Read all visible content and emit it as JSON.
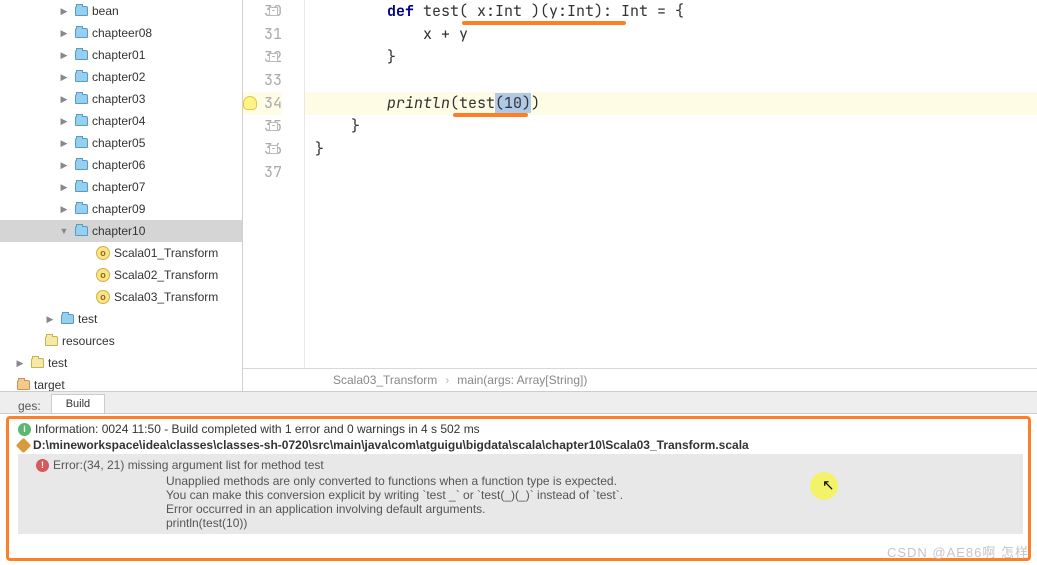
{
  "tree": {
    "items": [
      {
        "indent": 58,
        "arrow": ">",
        "icon": "folder",
        "label": "bean"
      },
      {
        "indent": 58,
        "arrow": ">",
        "icon": "folder",
        "label": "chapteer08"
      },
      {
        "indent": 58,
        "arrow": ">",
        "icon": "folder",
        "label": "chapter01"
      },
      {
        "indent": 58,
        "arrow": ">",
        "icon": "folder",
        "label": "chapter02"
      },
      {
        "indent": 58,
        "arrow": ">",
        "icon": "folder",
        "label": "chapter03"
      },
      {
        "indent": 58,
        "arrow": ">",
        "icon": "folder",
        "label": "chapter04"
      },
      {
        "indent": 58,
        "arrow": ">",
        "icon": "folder",
        "label": "chapter05"
      },
      {
        "indent": 58,
        "arrow": ">",
        "icon": "folder",
        "label": "chapter06"
      },
      {
        "indent": 58,
        "arrow": ">",
        "icon": "folder",
        "label": "chapter07"
      },
      {
        "indent": 58,
        "arrow": ">",
        "icon": "folder",
        "label": "chapter09"
      },
      {
        "indent": 58,
        "arrow": "v",
        "icon": "folder",
        "label": "chapter10",
        "sel": true
      },
      {
        "indent": 80,
        "arrow": "",
        "icon": "obj",
        "label": "Scala01_Transform"
      },
      {
        "indent": 80,
        "arrow": "",
        "icon": "obj",
        "label": "Scala02_Transform"
      },
      {
        "indent": 80,
        "arrow": "",
        "icon": "obj",
        "label": "Scala03_Transform"
      },
      {
        "indent": 44,
        "arrow": ">",
        "icon": "folder",
        "label": "test"
      },
      {
        "indent": 28,
        "arrow": "",
        "icon": "folder-res",
        "label": "resources"
      },
      {
        "indent": 14,
        "arrow": ">",
        "icon": "folder-res",
        "label": "test"
      },
      {
        "indent": 0,
        "arrow": "",
        "icon": "folder-tgt",
        "label": "target"
      }
    ]
  },
  "editor": {
    "lines": [
      {
        "num": "30",
        "fold": true
      },
      {
        "num": "31"
      },
      {
        "num": "32",
        "fold": true
      },
      {
        "num": "33"
      },
      {
        "num": "34",
        "hl": true,
        "bulb": true
      },
      {
        "num": "35",
        "fold": true
      },
      {
        "num": "36",
        "fold": true
      },
      {
        "num": "37"
      }
    ],
    "code30": {
      "pre": "        ",
      "kw": "def",
      "mid": " test( x:Int )(y:Int): Int = {"
    },
    "code31": "            x + y",
    "code32": "        }",
    "code33": "",
    "code34": {
      "pre": "        ",
      "fn": "println",
      "open": "(test",
      "sel": "(10)",
      "close": ")"
    },
    "code35": "    }",
    "code36": "}",
    "code37": ""
  },
  "breadcrumb": {
    "a": "Scala03_Transform",
    "b": "main(args: Array[String])"
  },
  "tabs": {
    "left": "ges:",
    "build": "Build"
  },
  "build": {
    "info": "Information: 0024 11:50 - Build completed with 1 error and 0 warnings in 4 s 502 ms",
    "path": "D:\\mineworkspace\\idea\\classes\\classes-sh-0720\\src\\main\\java\\com\\atguigu\\bigdata\\scala\\chapter10\\Scala03_Transform.scala",
    "err_head": "Error:(34, 21)   missing argument list for method test",
    "err1": "Unapplied methods are only converted to functions when a function type is expected.",
    "err2": "You can make this conversion explicit by writing `test _` or `test(_)(_)` instead of `test`.",
    "err3": "Error occurred in an application involving default arguments.",
    "err4": "        println(test(10))"
  },
  "watermark": "CSDN @AE86啊 怎样"
}
